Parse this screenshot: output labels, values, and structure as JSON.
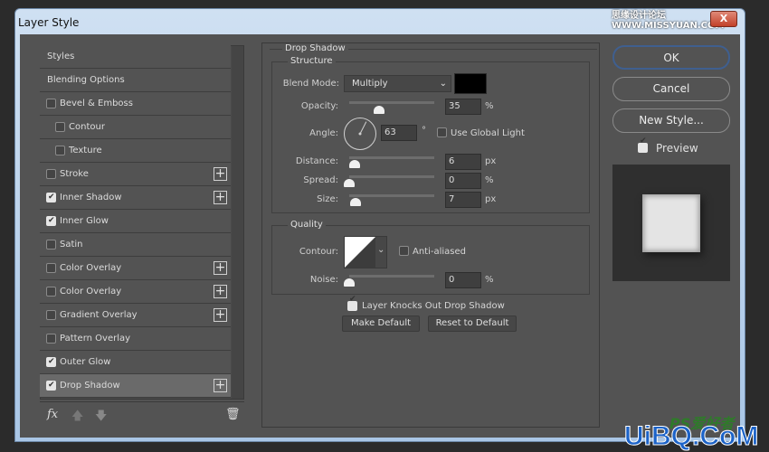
{
  "window": {
    "title": "Layer Style",
    "close_label": "X"
  },
  "watermarks": {
    "top": "思缘设计论坛 WWW.MISSYUAN.COM",
    "bottom": "UiBQ.CoM",
    "bottom_logo": "PS爱好者"
  },
  "styles_list": [
    {
      "label": "Styles",
      "checkbox": false,
      "checked": false,
      "indent": false,
      "plus": false,
      "selected": false
    },
    {
      "label": "Blending Options",
      "checkbox": false,
      "checked": false,
      "indent": false,
      "plus": false,
      "selected": false
    },
    {
      "label": "Bevel & Emboss",
      "checkbox": true,
      "checked": false,
      "indent": false,
      "plus": false,
      "selected": false
    },
    {
      "label": "Contour",
      "checkbox": true,
      "checked": false,
      "indent": true,
      "plus": false,
      "selected": false
    },
    {
      "label": "Texture",
      "checkbox": true,
      "checked": false,
      "indent": true,
      "plus": false,
      "selected": false
    },
    {
      "label": "Stroke",
      "checkbox": true,
      "checked": false,
      "indent": false,
      "plus": true,
      "selected": false
    },
    {
      "label": "Inner Shadow",
      "checkbox": true,
      "checked": true,
      "indent": false,
      "plus": true,
      "selected": false
    },
    {
      "label": "Inner Glow",
      "checkbox": true,
      "checked": true,
      "indent": false,
      "plus": false,
      "selected": false
    },
    {
      "label": "Satin",
      "checkbox": true,
      "checked": false,
      "indent": false,
      "plus": false,
      "selected": false
    },
    {
      "label": "Color Overlay",
      "checkbox": true,
      "checked": false,
      "indent": false,
      "plus": true,
      "selected": false
    },
    {
      "label": "Color Overlay",
      "checkbox": true,
      "checked": false,
      "indent": false,
      "plus": true,
      "selected": false
    },
    {
      "label": "Gradient Overlay",
      "checkbox": true,
      "checked": false,
      "indent": false,
      "plus": true,
      "selected": false
    },
    {
      "label": "Pattern Overlay",
      "checkbox": true,
      "checked": false,
      "indent": false,
      "plus": false,
      "selected": false
    },
    {
      "label": "Outer Glow",
      "checkbox": true,
      "checked": true,
      "indent": false,
      "plus": false,
      "selected": false
    },
    {
      "label": "Drop Shadow",
      "checkbox": true,
      "checked": true,
      "indent": false,
      "plus": true,
      "selected": true
    }
  ],
  "bottom_icons": {
    "fx": "fx",
    "up": "arrow-up-icon",
    "down": "arrow-down-icon",
    "trash": "trash-icon"
  },
  "drop_shadow": {
    "title": "Drop Shadow",
    "structure": {
      "title": "Structure",
      "blend_mode_label": "Blend Mode:",
      "blend_mode": "Multiply",
      "color": "#000000",
      "opacity": {
        "label": "Opacity:",
        "value": "35",
        "unit": "%",
        "level": 0.35
      },
      "angle": {
        "label": "Angle:",
        "value": "63",
        "unit": "°",
        "degrees": 63
      },
      "use_global_light": {
        "label": "Use Global Light",
        "checked": false
      },
      "distance": {
        "label": "Distance:",
        "value": "6",
        "unit": "px",
        "level": 0.06
      },
      "spread": {
        "label": "Spread:",
        "value": "0",
        "unit": "%",
        "level": 0
      },
      "size": {
        "label": "Size:",
        "value": "7",
        "unit": "px",
        "level": 0.07
      }
    },
    "quality": {
      "title": "Quality",
      "contour_label": "Contour:",
      "anti_aliased": {
        "label": "Anti-aliased",
        "checked": false
      },
      "noise": {
        "label": "Noise:",
        "value": "0",
        "unit": "%",
        "level": 0
      }
    },
    "knockout": {
      "label": "Layer Knocks Out Drop Shadow",
      "checked": true
    },
    "make_default": "Make Default",
    "reset_default": "Reset to Default"
  },
  "buttons": {
    "ok": "OK",
    "cancel": "Cancel",
    "new_style": "New Style...",
    "preview_label": "Preview",
    "preview_checked": true
  }
}
